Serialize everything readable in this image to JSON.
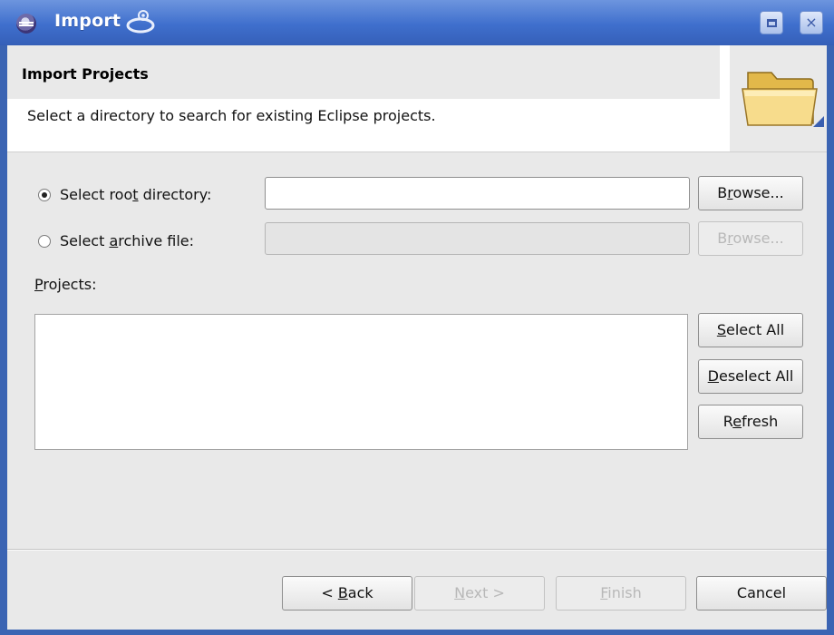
{
  "window": {
    "title": "Import",
    "maximize_icon": "maximize-icon",
    "close_icon": "close-icon",
    "close_glyph": "×"
  },
  "header": {
    "title": "Import Projects",
    "description": "Select a directory to search for existing Eclipse projects.",
    "icon": "folder-icon"
  },
  "source": {
    "root_option": {
      "label_before": "Select roo",
      "mnemonic": "t",
      "label_after": " directory:",
      "selected": true
    },
    "archive_option": {
      "label_before": "Select ",
      "mnemonic": "a",
      "label_after": "rchive file:",
      "selected": false
    },
    "root_input_value": "",
    "archive_input_value": "",
    "browse_root": {
      "before": "B",
      "mnemonic": "r",
      "after": "owse..."
    },
    "browse_archive": {
      "before": "B",
      "mnemonic": "r",
      "after": "owse..."
    }
  },
  "projects": {
    "label_mnemonic": "P",
    "label_rest": "rojects:",
    "items": [],
    "select_all": {
      "mnemonic": "S",
      "rest": "elect All"
    },
    "deselect_all": {
      "mnemonic": "D",
      "rest": "eselect All"
    },
    "refresh": {
      "before": "R",
      "mnemonic": "e",
      "after": "fresh"
    }
  },
  "footer": {
    "back": {
      "prefix": "< ",
      "mnemonic": "B",
      "rest": "ack"
    },
    "next": {
      "mnemonic": "N",
      "rest": "ext >"
    },
    "finish": {
      "mnemonic": "F",
      "rest": "inish"
    },
    "cancel": "Cancel"
  }
}
